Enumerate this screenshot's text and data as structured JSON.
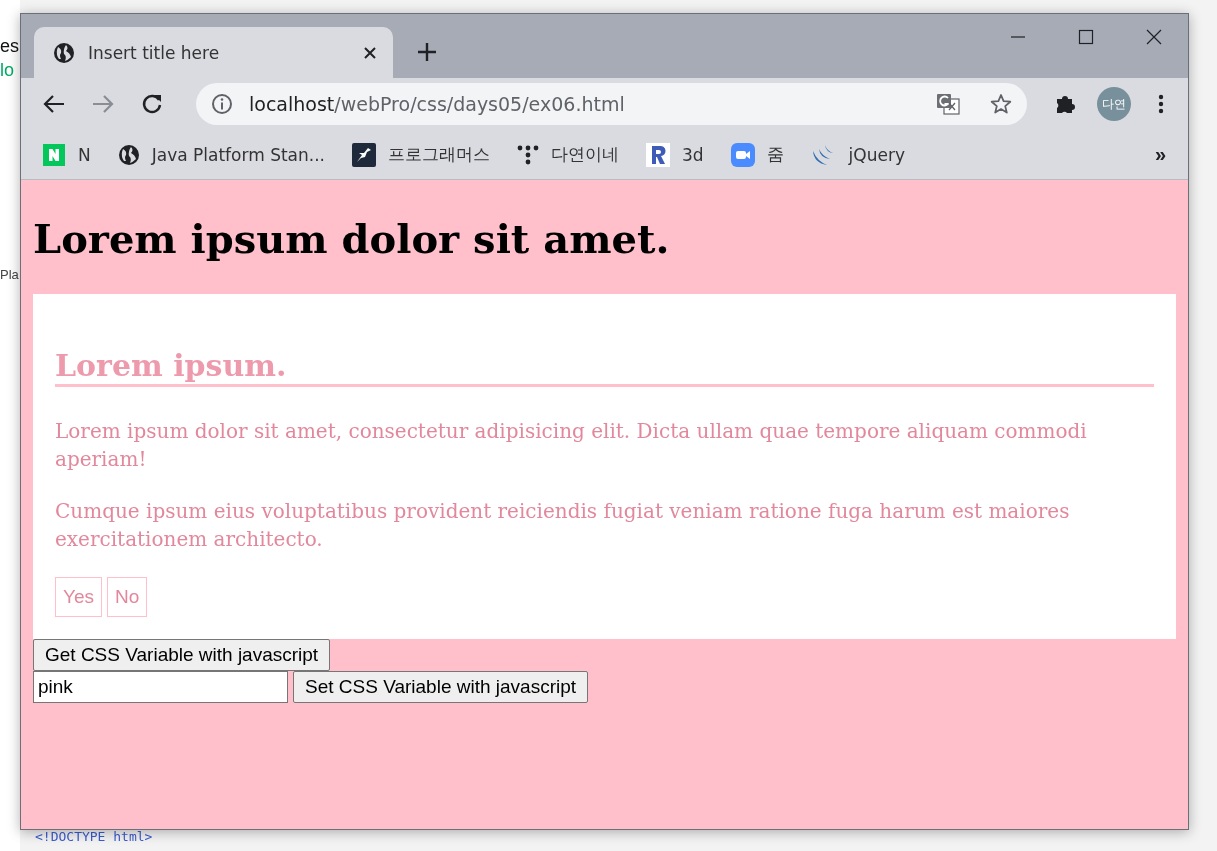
{
  "desktop": {
    "fragments": [
      {
        "text": "es"
      },
      {
        "text": "lo"
      },
      {
        "text": "Pla"
      }
    ],
    "code_line": "<!DOCTYPE html>"
  },
  "browser": {
    "tabs": [
      {
        "title": "Insert title here",
        "selected": true
      }
    ],
    "forward_disabled": true,
    "address": {
      "host": "localhost",
      "path": "/webPro/css/days05/ex06.html"
    },
    "profile": "다연",
    "bookmarks": [
      {
        "label": "N",
        "kind": "naver"
      },
      {
        "label": "Java Platform Stan...",
        "kind": "globe"
      },
      {
        "label": "프로그래머스",
        "kind": "bird"
      },
      {
        "label": "다연이네",
        "kind": "dots"
      },
      {
        "label": "3d",
        "kind": "r"
      },
      {
        "label": "줌",
        "kind": "zoom"
      },
      {
        "label": "jQuery",
        "kind": "jquery"
      }
    ],
    "overflow": "»"
  },
  "page": {
    "heading": "Lorem ipsum dolor sit amet.",
    "card": {
      "title": "Lorem ipsum.",
      "paragraphs": [
        "Lorem ipsum dolor sit amet, consectetur adipisicing elit. Dicta ullam quae tempore aliquam commodi aperiam!",
        "Cumque ipsum eius voluptatibus provident reiciendis fugiat veniam ratione fuga harum est maiores exercitationem architecto."
      ],
      "buttons": [
        "Yes",
        "No"
      ]
    },
    "get_button": "Get CSS Variable with javascript",
    "color_input": {
      "value": "pink"
    },
    "set_button": "Set CSS Variable with javascript"
  }
}
